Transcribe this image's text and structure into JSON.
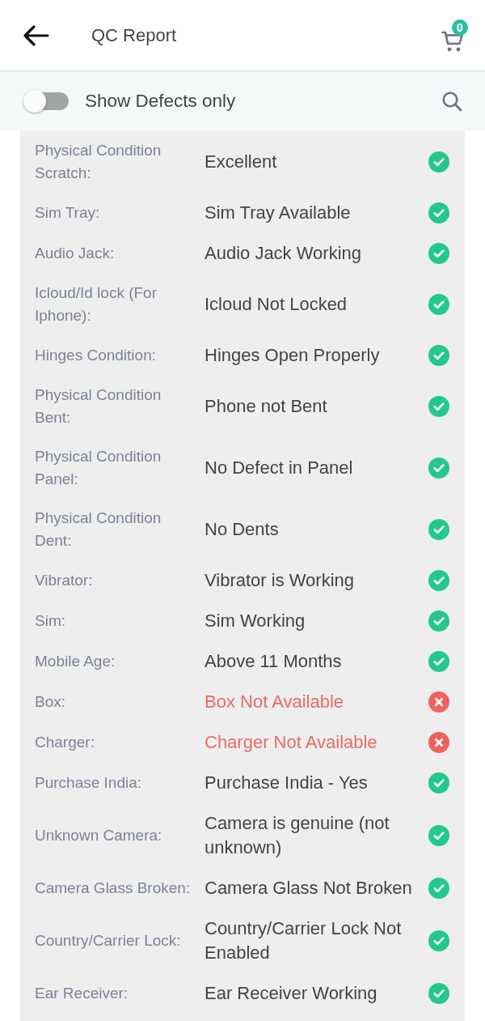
{
  "header": {
    "title": "QC Report",
    "cart_count": "0"
  },
  "filter": {
    "label": "Show Defects only",
    "on": false
  },
  "checks": [
    {
      "label": "Physical Condition Scratch:",
      "value": "Excellent",
      "passed": true
    },
    {
      "label": "Sim Tray:",
      "value": "Sim Tray Available",
      "passed": true
    },
    {
      "label": "Audio Jack:",
      "value": "Audio Jack Working",
      "passed": true
    },
    {
      "label": "Icloud/Id lock (For Iphone):",
      "value": "Icloud Not Locked",
      "passed": true
    },
    {
      "label": "Hinges Condition:",
      "value": "Hinges Open Properly",
      "passed": true
    },
    {
      "label": "Physical Condition Bent:",
      "value": "Phone not Bent",
      "passed": true
    },
    {
      "label": "Physical Condition Panel:",
      "value": "No Defect in Panel",
      "passed": true
    },
    {
      "label": "Physical Condition Dent:",
      "value": "No Dents",
      "passed": true
    },
    {
      "label": "Vibrator:",
      "value": "Vibrator is Working",
      "passed": true
    },
    {
      "label": "Sim:",
      "value": "Sim Working",
      "passed": true
    },
    {
      "label": "Mobile Age:",
      "value": "Above 11 Months",
      "passed": true
    },
    {
      "label": "Box:",
      "value": "Box Not Available",
      "passed": false
    },
    {
      "label": "Charger:",
      "value": "Charger Not Available",
      "passed": false
    },
    {
      "label": "Purchase India:",
      "value": "Purchase India - Yes",
      "passed": true
    },
    {
      "label": "Unknown Camera:",
      "value": "Camera is genuine (not unknown)",
      "passed": true
    },
    {
      "label": "Camera Glass Broken:",
      "value": "Camera Glass Not Broken",
      "passed": true
    },
    {
      "label": "Country/Carrier Lock:",
      "value": "Country/Carrier Lock Not Enabled",
      "passed": true
    },
    {
      "label": "Ear Receiver:",
      "value": "Ear Receiver Working",
      "passed": true
    }
  ]
}
